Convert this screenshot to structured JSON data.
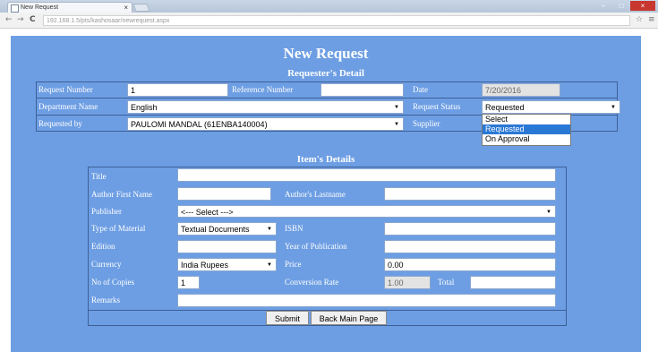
{
  "browser": {
    "tab_title": "New Request",
    "tab_close": "×",
    "url": "192.168.1.5/pts/kashosaar/newrequest.aspx",
    "back": "←",
    "forward": "→",
    "reload": "C",
    "window_controls": [
      "−",
      "□",
      "×"
    ],
    "star": "☆",
    "menu": "≡"
  },
  "page": {
    "title": "New Request",
    "requester_heading": "Requester's Detail",
    "items_heading": "Item's Details"
  },
  "requester": {
    "request_number_label": "Request Number",
    "request_number_value": "1",
    "reference_number_label": "Reference Number",
    "reference_number_value": "",
    "date_label": "Date",
    "date_value": "7/20/2016",
    "department_label": "Department Name",
    "department_value": "English",
    "request_status_label": "Request Status",
    "request_status_value": "Requested",
    "request_status_options": [
      "Select",
      "Requested",
      "On Approval"
    ],
    "requested_by_label": "Requested by",
    "requested_by_value": "PAULOMI MANDAL (61ENBA140004)",
    "supplier_label": "Supplier"
  },
  "items": {
    "title_label": "Title",
    "author_first_label": "Author First Name",
    "author_last_label": "Author's Lastname",
    "publisher_label": "Publisher",
    "publisher_value": "<--- Select --->",
    "type_label": "Type of Material",
    "type_value": "Textual Documents",
    "isbn_label": "ISBN",
    "edition_label": "Edition",
    "year_label": "Year of Publication",
    "currency_label": "Currency",
    "currency_value": "India Rupees",
    "price_label": "Price",
    "price_value": "0.00",
    "copies_label": "No of Copies",
    "copies_value": "1",
    "conversion_label": "Conversion Rate",
    "conversion_value": "1.00",
    "total_label": "Total",
    "remarks_label": "Remarks"
  },
  "buttons": {
    "submit": "Submit",
    "back": "Back Main Page"
  }
}
